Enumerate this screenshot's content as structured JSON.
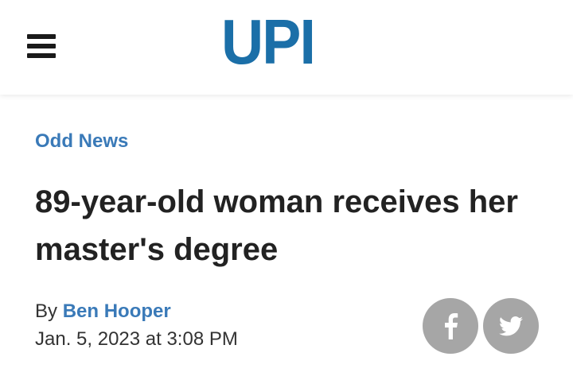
{
  "header": {
    "logo_text": "UPI",
    "menu_icon": "hamburger-menu-icon"
  },
  "article": {
    "category": "Odd News",
    "headline": "89-year-old woman receives her master's degree",
    "byline_prefix": "By",
    "author": "Ben Hooper",
    "dateline": "Jan. 5, 2023 at 3:08 PM"
  },
  "share": {
    "facebook_icon": "facebook-icon",
    "twitter_icon": "twitter-icon"
  },
  "colors": {
    "brand_blue": "#1b6fa8",
    "link_blue": "#3a7ab8",
    "share_gray": "#a6a6a6",
    "headline_text": "#222222",
    "menu_dark": "#1a1a1a"
  }
}
